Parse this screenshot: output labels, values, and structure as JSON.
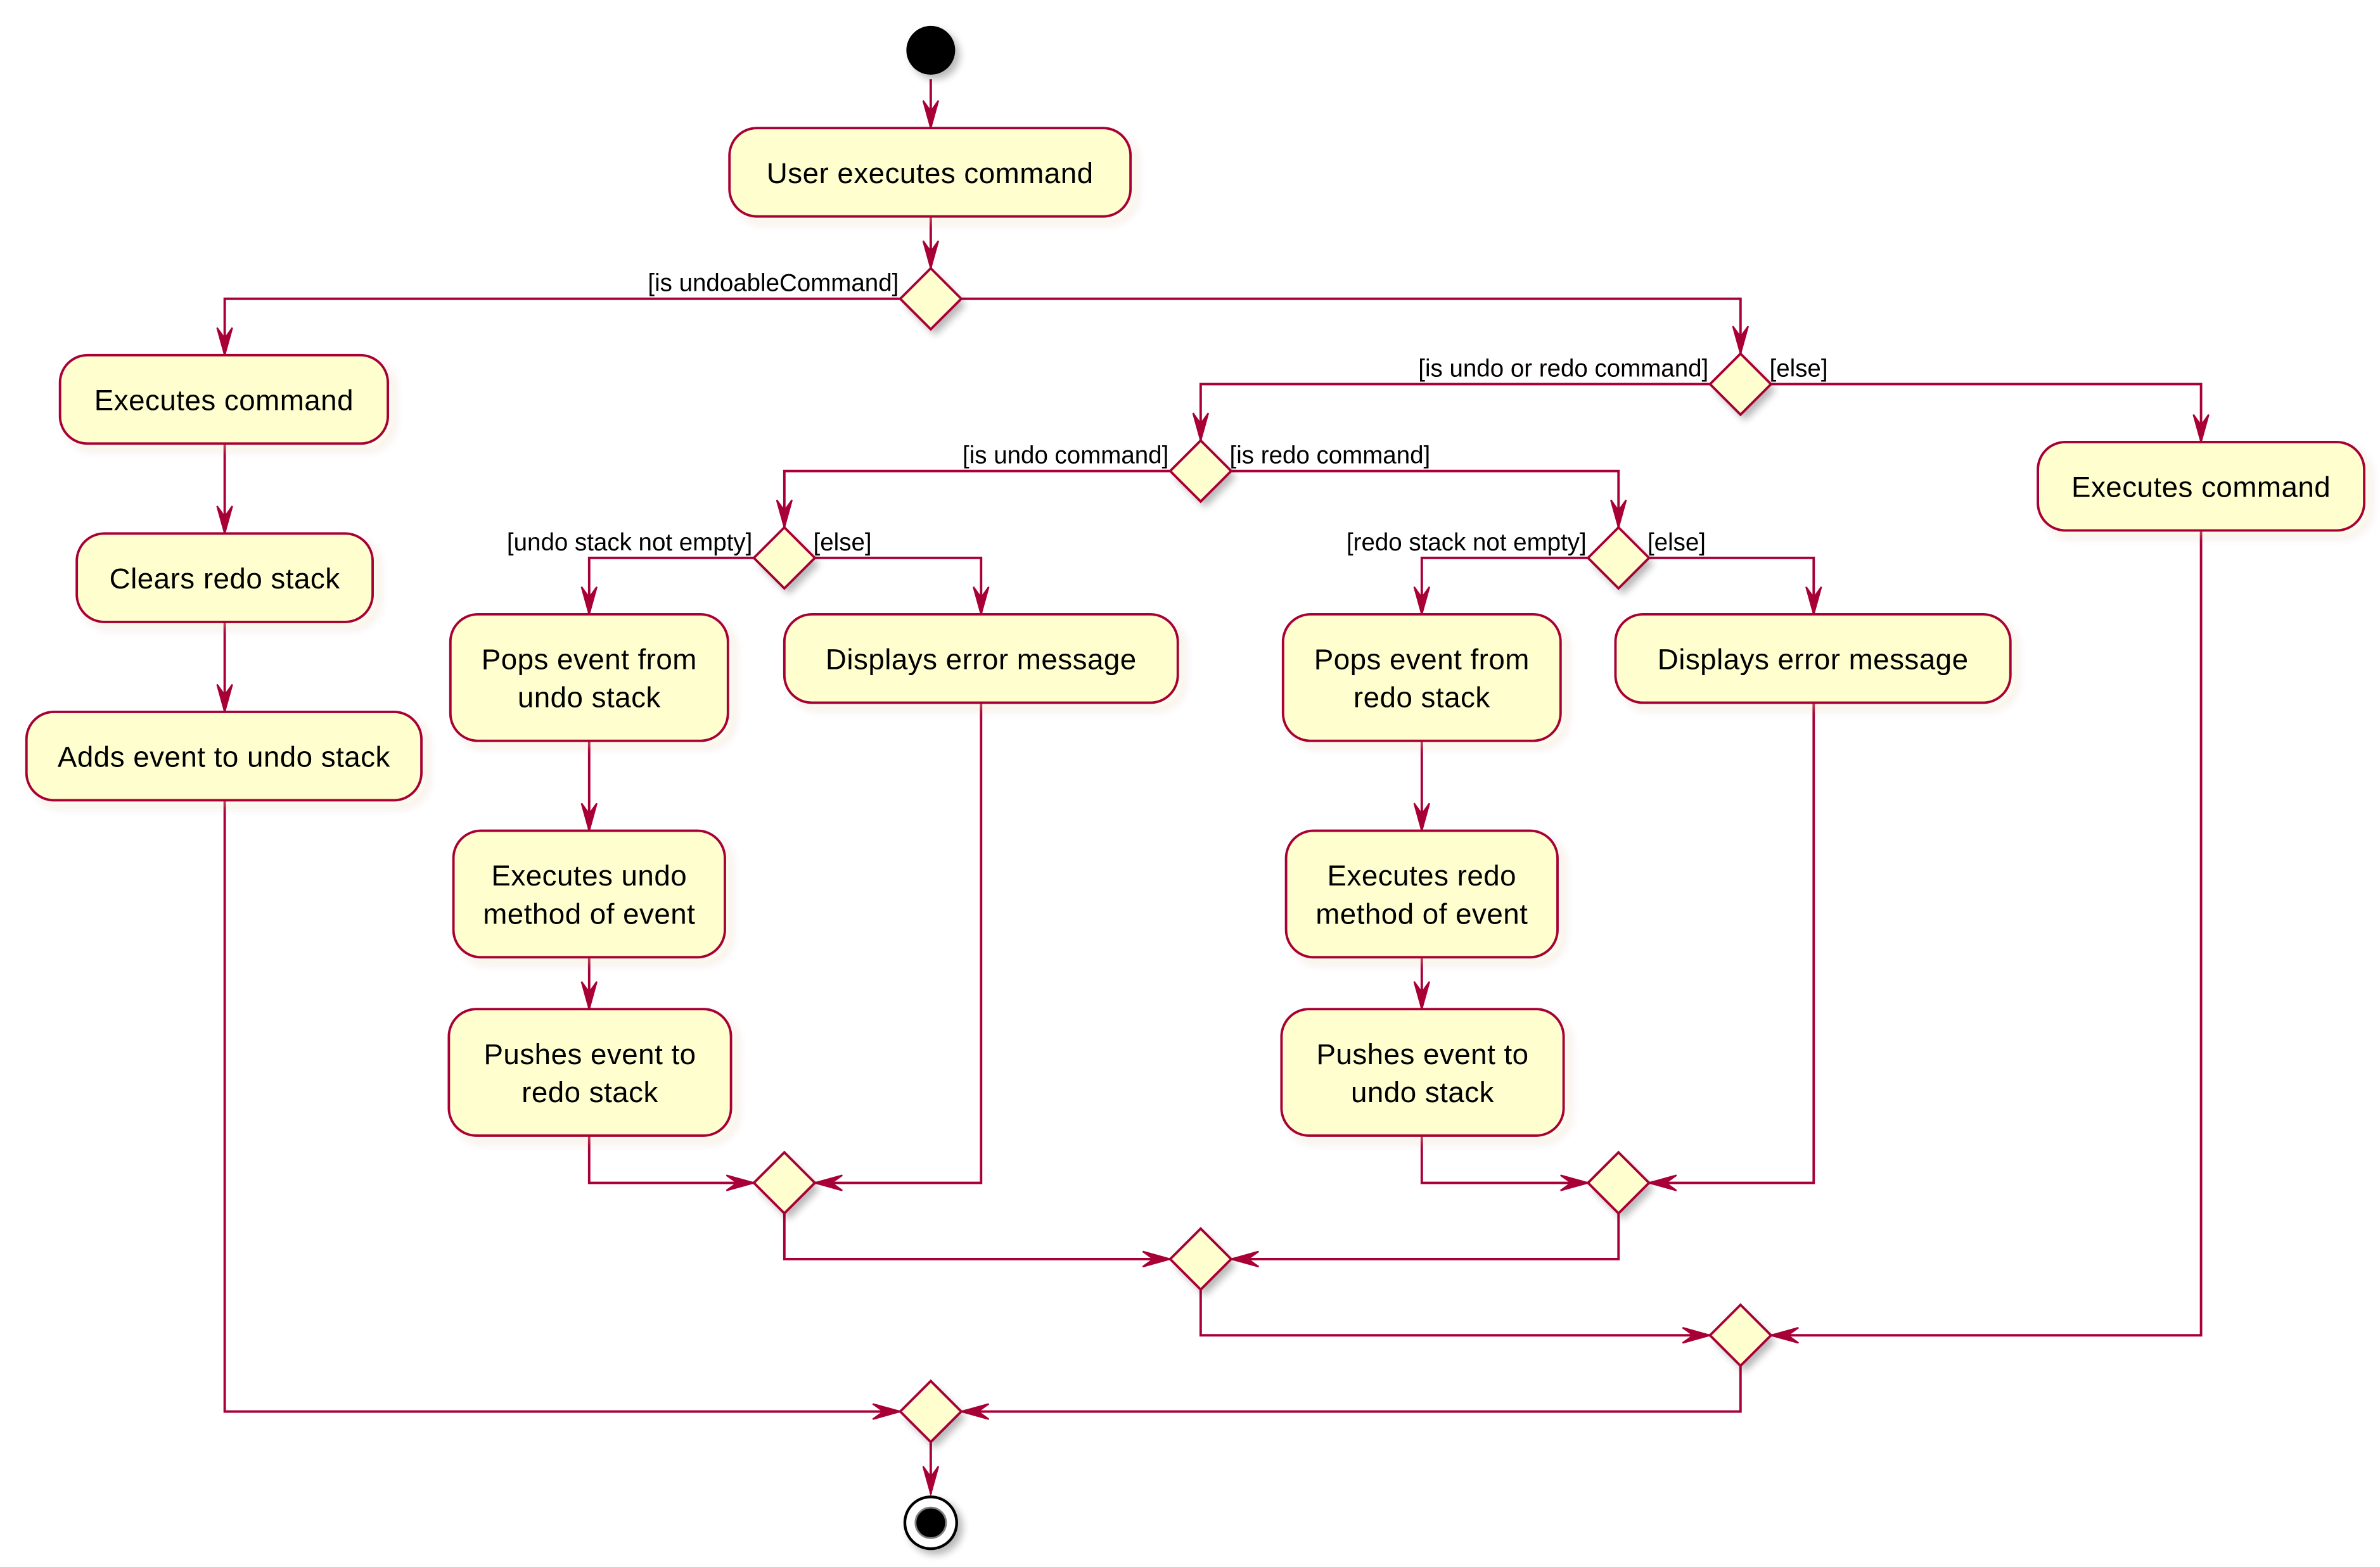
{
  "diagram": {
    "type": "uml-activity",
    "colors": {
      "line": "#A80036",
      "fill": "#FEFECE",
      "text": "#000000",
      "background": "#FFFFFF"
    },
    "start": {
      "id": "start"
    },
    "end": {
      "id": "end"
    },
    "activities": [
      {
        "id": "user-exec",
        "lines": [
          "User executes command"
        ]
      },
      {
        "id": "exec-undoable",
        "lines": [
          "Executes command"
        ]
      },
      {
        "id": "clear-redo",
        "lines": [
          "Clears redo stack"
        ]
      },
      {
        "id": "add-undo",
        "lines": [
          "Adds event to undo stack"
        ]
      },
      {
        "id": "pop-undo",
        "lines": [
          "Pops event from",
          "undo stack"
        ]
      },
      {
        "id": "err-undo",
        "lines": [
          "Displays error message"
        ]
      },
      {
        "id": "exec-undo",
        "lines": [
          "Executes undo",
          "method of event"
        ]
      },
      {
        "id": "push-redo",
        "lines": [
          "Pushes event to",
          "redo stack"
        ]
      },
      {
        "id": "pop-redo",
        "lines": [
          "Pops event from",
          "redo stack"
        ]
      },
      {
        "id": "err-redo",
        "lines": [
          "Displays error message"
        ]
      },
      {
        "id": "exec-redo",
        "lines": [
          "Executes redo",
          "method of event"
        ]
      },
      {
        "id": "push-undo",
        "lines": [
          "Pushes event to",
          "undo stack"
        ]
      },
      {
        "id": "exec-other",
        "lines": [
          "Executes command"
        ]
      }
    ],
    "decisions": [
      {
        "id": "d-undoable",
        "left_guard": "[is undoableCommand]",
        "right_guard": ""
      },
      {
        "id": "d-undoredo",
        "left_guard": "[is undo or redo command]",
        "right_guard": "[else]"
      },
      {
        "id": "d-undo-or-redo",
        "left_guard": "[is undo command]",
        "right_guard": "[is redo command]"
      },
      {
        "id": "d-undo-empty",
        "left_guard": "[undo stack not empty]",
        "right_guard": "[else]"
      },
      {
        "id": "d-redo-empty",
        "left_guard": "[redo stack not empty]",
        "right_guard": "[else]"
      }
    ],
    "merges": [
      {
        "id": "m-undo"
      },
      {
        "id": "m-redo"
      },
      {
        "id": "m-undoredo"
      },
      {
        "id": "m-else"
      },
      {
        "id": "m-final"
      }
    ]
  }
}
